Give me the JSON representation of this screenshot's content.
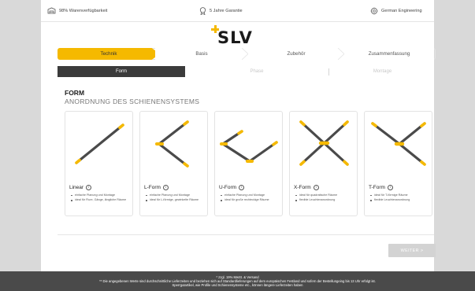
{
  "topbar": {
    "availability": "98% Warenverfügbarkeit",
    "guarantee": "5 Jahre Garantie",
    "engineering": "German Engineering"
  },
  "logo": {
    "text": "SLV",
    "accent_color": "#f5b900"
  },
  "steps": [
    {
      "label": "Technik",
      "active": true
    },
    {
      "label": "Basis",
      "active": false
    },
    {
      "label": "Zubehör",
      "active": false
    },
    {
      "label": "Zusammenfassung",
      "active": false
    }
  ],
  "subtabs": [
    {
      "label": "Form",
      "active": true
    },
    {
      "label": "Phase",
      "active": false
    },
    {
      "label": "Montage",
      "active": false
    }
  ],
  "section": {
    "title": "FORM",
    "subtitle": "ANORDNUNG DES SCHIENENSYSTEMS"
  },
  "cards": [
    {
      "title": "Linear",
      "bullets": [
        "einfache Planung und Montage",
        "ideal für Flure, Gänge, längliche Räume"
      ]
    },
    {
      "title": "L-Form",
      "bullets": [
        "einfache Planung und Montage",
        "ideal für L-förmige, gewinkelte Räume"
      ]
    },
    {
      "title": "U-Form",
      "bullets": [
        "einfache Planung und Montage",
        "ideal für große rechteckige Räume"
      ]
    },
    {
      "title": "X-Form",
      "bullets": [
        "ideal für quadratische Räume",
        "flexible Leuchtenanordnung"
      ]
    },
    {
      "title": "T-Form",
      "bullets": [
        "ideal für T-förmige Räume",
        "flexible Leuchtenanordnung"
      ]
    }
  ],
  "info_glyph": "i",
  "next_button": "WEITER  >",
  "footer": {
    "line1": "* zzgl. 19% MwSt. & Versand",
    "line2": "** Die angegebenen Werte sind durchschnittliche Lieferzeiten und beziehen sich auf Standardlieferungen auf dem europäischen Festland und sofern der Bestellungeing bis 13 Uhr erfolgt ist.",
    "line3": "Sperrgutartikel, wie Profile und Schienensysteme etc., können längere Lieferzeiten haben"
  },
  "colors": {
    "accent": "#f5b900",
    "dark": "#3b3b3b",
    "rail": "#4a4a4a",
    "footer": "#4a4a4a"
  },
  "icons": [
    "warehouse-icon",
    "guarantee-seal-icon",
    "gear-engineering-icon",
    "info-icon"
  ]
}
